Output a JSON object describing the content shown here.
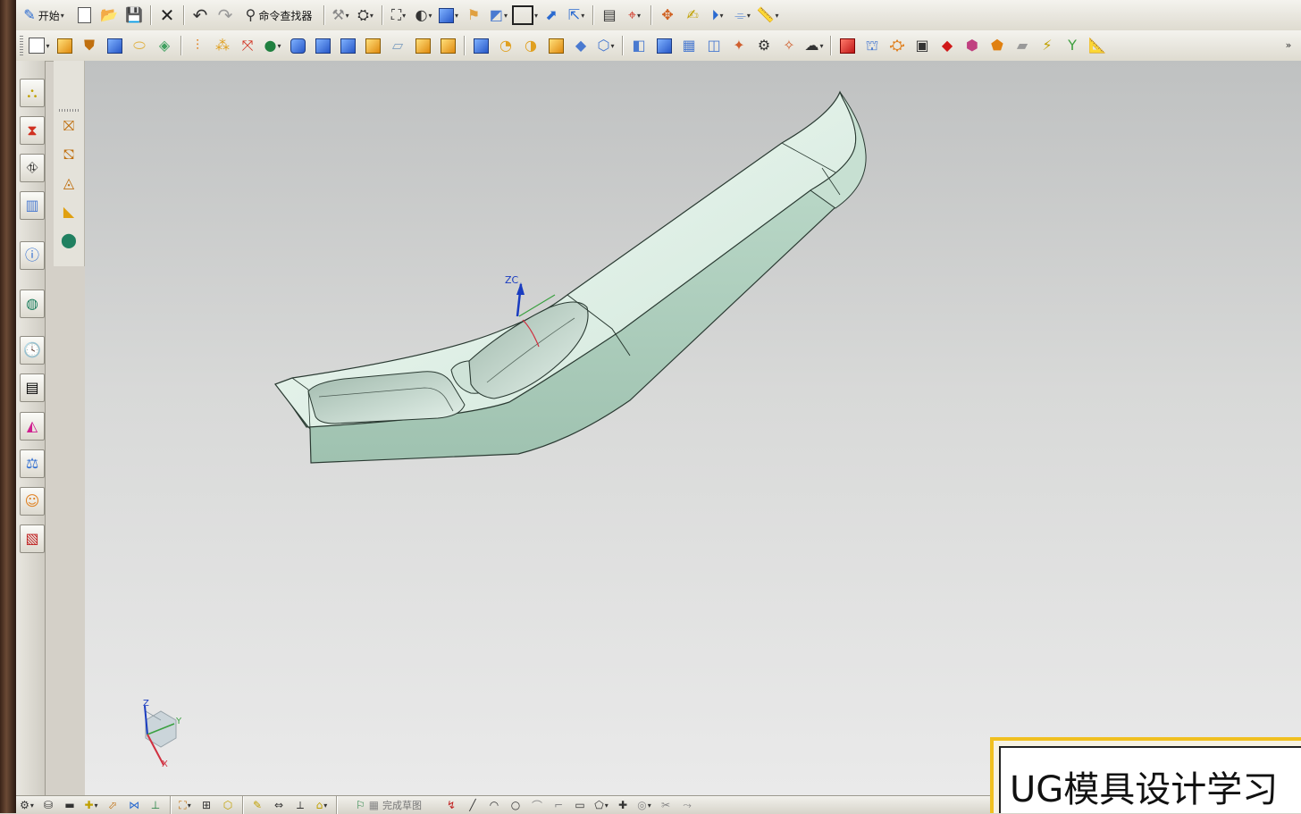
{
  "toolbar_top": {
    "start_label": "开始",
    "command_finder_label": "命令查找器"
  },
  "bottom_toolbar": {
    "finish_sketch_label": "完成草图"
  },
  "viewport": {
    "wcs_axis_z": "ZC",
    "triad_axis_z": "Z",
    "triad_axis_y": "Y",
    "triad_axis_x": "X"
  },
  "watermark": {
    "title": "UG模具设计学习"
  },
  "colors": {
    "part_fill": "#d9ece2",
    "part_edge": "#2a3a32",
    "toolbar_bg": "#e9e7df",
    "frame_brown": "#4a2f22",
    "watermark_border": "#f0c020"
  }
}
